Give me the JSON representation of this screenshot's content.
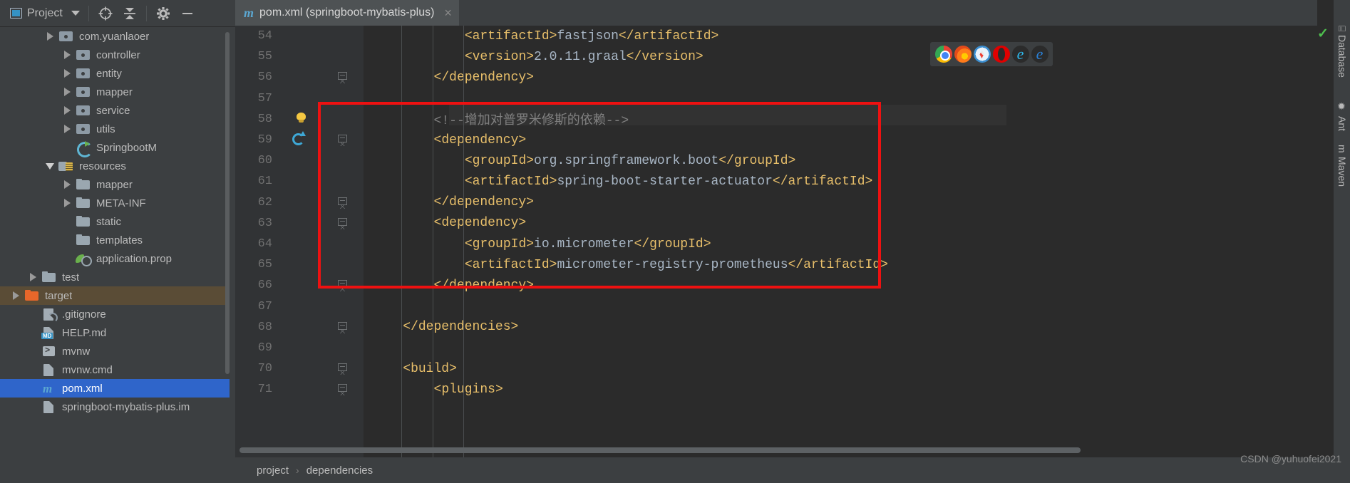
{
  "project_toolbar": {
    "label": "Project",
    "icons": [
      "project-window-icon",
      "chevron-down-icon",
      "locate-icon",
      "collapse-all-icon",
      "settings-gear-icon",
      "hide-icon"
    ]
  },
  "file_tree": [
    {
      "label": "com.yuanlaoer",
      "indent": 2,
      "arrow": "right",
      "icon": "package-folder",
      "state": "partial",
      "selected": "none"
    },
    {
      "label": "controller",
      "indent": 3,
      "arrow": "right",
      "icon": "package-folder",
      "selected": "none"
    },
    {
      "label": "entity",
      "indent": 3,
      "arrow": "right",
      "icon": "package-folder",
      "selected": "none"
    },
    {
      "label": "mapper",
      "indent": 3,
      "arrow": "right",
      "icon": "package-folder",
      "selected": "none"
    },
    {
      "label": "service",
      "indent": 3,
      "arrow": "right",
      "icon": "package-folder",
      "selected": "none"
    },
    {
      "label": "utils",
      "indent": 3,
      "arrow": "right",
      "icon": "package-folder",
      "selected": "none"
    },
    {
      "label": "SpringbootM",
      "indent": 3,
      "arrow": "none",
      "icon": "spring-class",
      "selected": "none"
    },
    {
      "label": "resources",
      "indent": 2,
      "arrow": "down",
      "icon": "resources-folder",
      "selected": "none"
    },
    {
      "label": "mapper",
      "indent": 3,
      "arrow": "right",
      "icon": "plain-folder",
      "selected": "none"
    },
    {
      "label": "META-INF",
      "indent": 3,
      "arrow": "right",
      "icon": "plain-folder",
      "selected": "none"
    },
    {
      "label": "static",
      "indent": 3,
      "arrow": "none",
      "icon": "plain-folder",
      "selected": "none"
    },
    {
      "label": "templates",
      "indent": 3,
      "arrow": "none",
      "icon": "plain-folder",
      "selected": "none"
    },
    {
      "label": "application.prop",
      "indent": 3,
      "arrow": "none",
      "icon": "properties-file",
      "selected": "none"
    },
    {
      "label": "test",
      "indent": 1,
      "arrow": "right",
      "icon": "plain-folder",
      "selected": "none"
    },
    {
      "label": "target",
      "indent": 0,
      "arrow": "right",
      "icon": "target-folder",
      "selected": "brown"
    },
    {
      "label": ".gitignore",
      "indent": 1,
      "arrow": "none",
      "icon": "gitignore-file",
      "selected": "none"
    },
    {
      "label": "HELP.md",
      "indent": 1,
      "arrow": "none",
      "icon": "markdown-file",
      "selected": "none"
    },
    {
      "label": "mvnw",
      "indent": 1,
      "arrow": "none",
      "icon": "terminal-file",
      "selected": "none"
    },
    {
      "label": "mvnw.cmd",
      "indent": 1,
      "arrow": "none",
      "icon": "text-file",
      "selected": "none"
    },
    {
      "label": "pom.xml",
      "indent": 1,
      "arrow": "none",
      "icon": "maven-file",
      "selected": "blue"
    },
    {
      "label": "springboot-mybatis-plus.im",
      "indent": 1,
      "arrow": "none",
      "icon": "iml-file",
      "selected": "none"
    }
  ],
  "tab": {
    "title": "pom.xml (springboot-mybatis-plus)",
    "icon": "maven-file-icon",
    "close": "×"
  },
  "editor": {
    "lines": [
      {
        "num": "54",
        "indent": 3,
        "segments": [
          {
            "t": "<artifactId>",
            "c": "tag"
          },
          {
            "t": "fastjson",
            "c": "text"
          },
          {
            "t": "</artifactId>",
            "c": "tag"
          }
        ]
      },
      {
        "num": "55",
        "indent": 3,
        "segments": [
          {
            "t": "<version>",
            "c": "tag"
          },
          {
            "t": "2.0.11.graal",
            "c": "text"
          },
          {
            "t": "</version>",
            "c": "tag"
          }
        ]
      },
      {
        "num": "56",
        "indent": 2,
        "fold": "up",
        "segments": [
          {
            "t": "</dependency>",
            "c": "tag"
          }
        ]
      },
      {
        "num": "57",
        "indent": 0,
        "segments": []
      },
      {
        "num": "58",
        "indent": 2,
        "bulb": true,
        "segments": [
          {
            "t": "<!--增加对普罗米修斯的依赖-->",
            "c": "comment"
          }
        ]
      },
      {
        "num": "59",
        "indent": 2,
        "run": true,
        "fold": "down",
        "segments": [
          {
            "t": "<dependency>",
            "c": "tag"
          }
        ]
      },
      {
        "num": "60",
        "indent": 3,
        "segments": [
          {
            "t": "<groupId>",
            "c": "tag"
          },
          {
            "t": "org.springframework.boot",
            "c": "text"
          },
          {
            "t": "</groupId>",
            "c": "tag"
          }
        ]
      },
      {
        "num": "61",
        "indent": 3,
        "segments": [
          {
            "t": "<artifactId>",
            "c": "tag"
          },
          {
            "t": "spring-boot-starter-actuator",
            "c": "text"
          },
          {
            "t": "</artifactId>",
            "c": "tag"
          }
        ]
      },
      {
        "num": "62",
        "indent": 2,
        "fold": "up",
        "segments": [
          {
            "t": "</dependency>",
            "c": "tag"
          }
        ]
      },
      {
        "num": "63",
        "indent": 2,
        "fold": "down",
        "segments": [
          {
            "t": "<dependency>",
            "c": "tag"
          }
        ]
      },
      {
        "num": "64",
        "indent": 3,
        "segments": [
          {
            "t": "<groupId>",
            "c": "tag"
          },
          {
            "t": "io.micrometer",
            "c": "text"
          },
          {
            "t": "</groupId>",
            "c": "tag"
          }
        ]
      },
      {
        "num": "65",
        "indent": 3,
        "segments": [
          {
            "t": "<artifactId>",
            "c": "tag"
          },
          {
            "t": "micrometer-registry-prometheus",
            "c": "text"
          },
          {
            "t": "</artifactId>",
            "c": "tag"
          }
        ]
      },
      {
        "num": "66",
        "indent": 2,
        "fold": "up",
        "segments": [
          {
            "t": "</dependency>",
            "c": "tag"
          }
        ]
      },
      {
        "num": "67",
        "indent": 0,
        "segments": []
      },
      {
        "num": "68",
        "indent": 1,
        "fold": "up",
        "segments": [
          {
            "t": "</dependencies>",
            "c": "tag"
          }
        ]
      },
      {
        "num": "69",
        "indent": 0,
        "segments": []
      },
      {
        "num": "70",
        "indent": 1,
        "fold": "down",
        "segments": [
          {
            "t": "<build>",
            "c": "tag"
          }
        ]
      },
      {
        "num": "71",
        "indent": 2,
        "fold": "down",
        "segments": [
          {
            "t": "<plugins>",
            "c": "tag"
          }
        ]
      }
    ],
    "highlight_color": "#ee1111"
  },
  "browser_strip": {
    "icons": [
      "chrome-icon",
      "firefox-icon",
      "safari-icon",
      "opera-icon",
      "edge-legacy-icon",
      "edge-chromium-icon"
    ],
    "glyphs": [
      "",
      "",
      "",
      "",
      "e",
      "e"
    ]
  },
  "breadcrumb": {
    "items": [
      "project",
      "dependencies"
    ],
    "separator": "›"
  },
  "right_toolbar": [
    {
      "label": "Database",
      "icon": "database-icon",
      "glyph": "⌸"
    },
    {
      "label": "Ant",
      "icon": "ant-icon",
      "glyph": "✹"
    },
    {
      "label": "Maven",
      "icon": "maven-icon",
      "glyph": "m"
    }
  ],
  "status": {
    "inspection_check": "✓",
    "watermark": "CSDN @yuhuofei2021"
  }
}
